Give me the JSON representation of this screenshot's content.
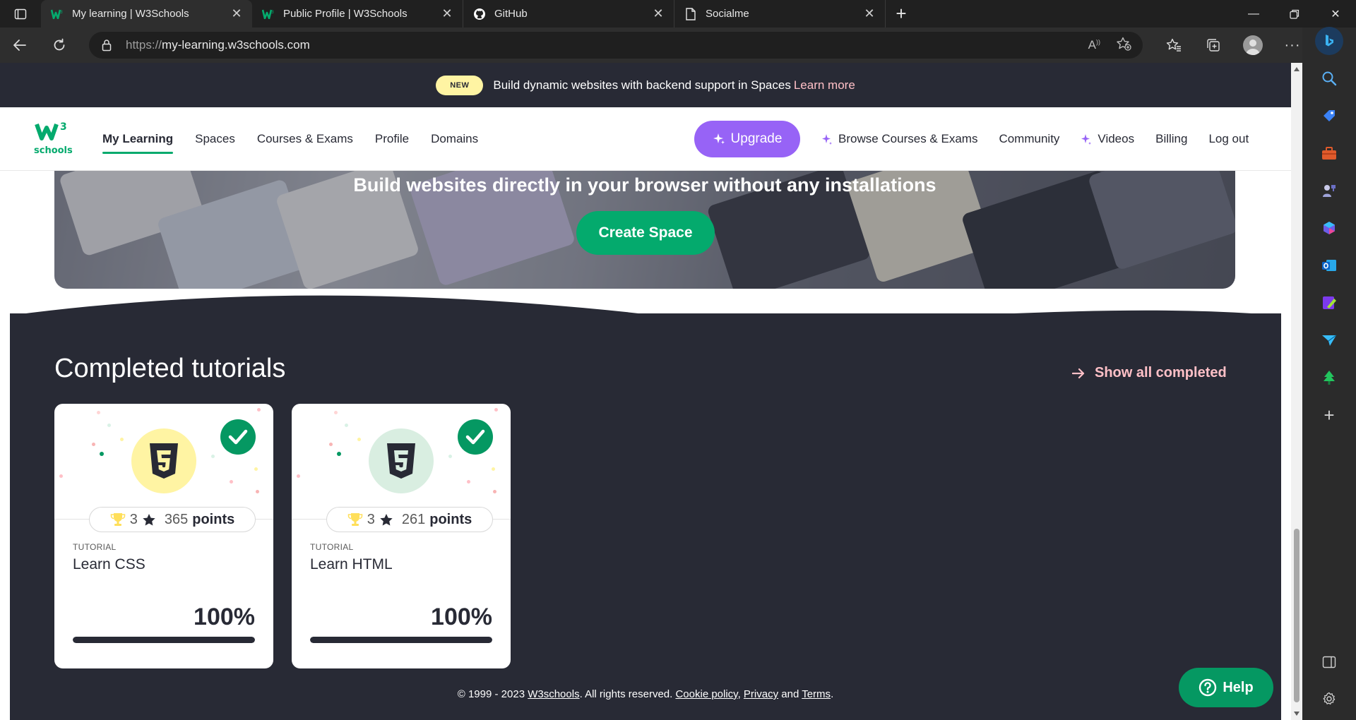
{
  "browser": {
    "tabs": [
      {
        "title": "My learning | W3Schools",
        "active": true,
        "favicon": "w3schools-icon"
      },
      {
        "title": "Public Profile | W3Schools",
        "active": false,
        "favicon": "w3schools-icon"
      },
      {
        "title": "GitHub",
        "active": false,
        "favicon": "github-icon"
      },
      {
        "title": "Socialme",
        "active": false,
        "favicon": "document-icon"
      }
    ],
    "url_protocol": "https://",
    "url_host": "my-learning.w3schools.com"
  },
  "promo": {
    "badge": "NEW",
    "message": "Build dynamic websites with backend support in Spaces",
    "link": "Learn more"
  },
  "nav": {
    "logo_sup": "3",
    "logo_text": "schools",
    "left_items": [
      "My Learning",
      "Spaces",
      "Courses & Exams",
      "Profile",
      "Domains"
    ],
    "active_item": "My Learning",
    "upgrade": "Upgrade",
    "right_items": {
      "browse": "Browse Courses & Exams",
      "community": "Community",
      "videos": "Videos",
      "billing": "Billing",
      "logout": "Log out"
    }
  },
  "spaces_banner": {
    "title": "Build websites directly in your browser without any installations",
    "button": "Create Space"
  },
  "completed": {
    "title": "Completed tutorials",
    "show_all": "Show all completed",
    "cards": [
      {
        "kind": "TUTORIAL",
        "name": "Learn CSS",
        "trophies": "3",
        "points_value": "365",
        "points_label": "points",
        "percent": "100%",
        "progress": 1.0,
        "icon": "css3-shield-icon",
        "badge_color": "#fff4a3"
      },
      {
        "kind": "TUTORIAL",
        "name": "Learn HTML",
        "trophies": "3",
        "points_value": "261",
        "points_label": "points",
        "percent": "100%",
        "progress": 1.0,
        "icon": "html5-shield-icon",
        "badge_color": "#d9eee1"
      }
    ]
  },
  "footer": {
    "copyright": "© 1999 - 2023",
    "brand": "W3schools",
    "rights": ". All rights reserved.",
    "cookie": "Cookie policy",
    "comma": ",",
    "privacy": "Privacy",
    "and": "and",
    "terms": "Terms",
    "period": "."
  },
  "help": {
    "label": "Help"
  },
  "colors": {
    "w3_green": "#04aa6d",
    "dark_bg": "#282a35",
    "upgrade_purple": "#9763f6",
    "pink_link": "#ffc0c7"
  }
}
